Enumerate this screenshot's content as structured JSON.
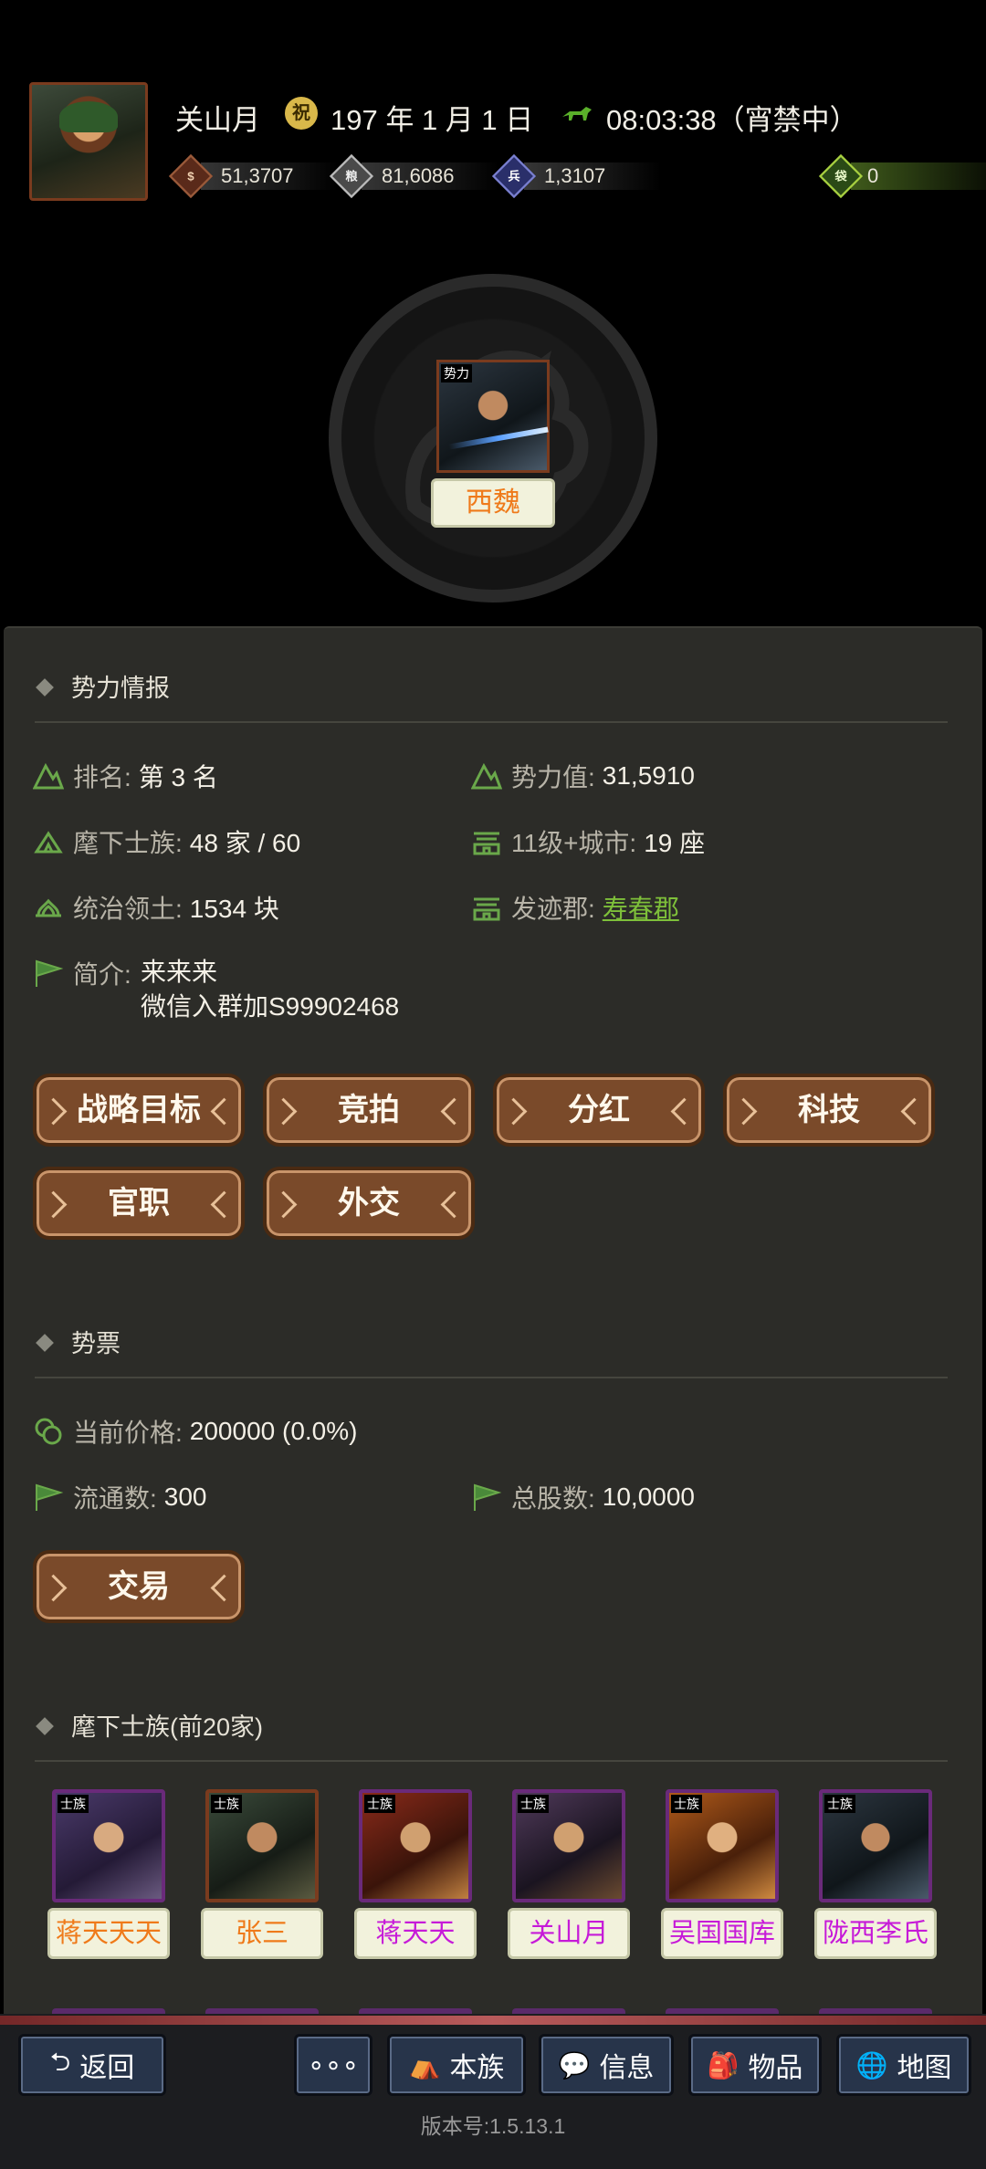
{
  "header": {
    "player_name": "关山月",
    "date_icon_glyph": "祝",
    "date": "197 年 1 月 1 日",
    "time": "08:03:38（宵禁中）",
    "resources": [
      {
        "icon": "coin-icon",
        "glyph": "$",
        "value": "51,3707"
      },
      {
        "icon": "grain-icon",
        "glyph": "粮",
        "value": "81,6086"
      },
      {
        "icon": "troop-icon",
        "glyph": "兵",
        "value": "1,3107"
      },
      {
        "icon": "bag-icon",
        "glyph": "袋",
        "value": "0"
      }
    ]
  },
  "faction": {
    "avatar_tag": "势力",
    "name": "西魏"
  },
  "power_info": {
    "title": "势力情报",
    "rank_label": "排名:",
    "rank_value": "第 3 名",
    "power_label": "势力值:",
    "power_value": "31,5910",
    "clans_label": "麾下士族:",
    "clans_value": "48 家 / 60",
    "cities_label": "11级+城市:",
    "cities_value": "19 座",
    "territory_label": "统治领土:",
    "territory_value": "1534 块",
    "origin_label": "发迹郡:",
    "origin_value": "寿春郡",
    "intro_label": "简介:",
    "intro_line1": "来来来",
    "intro_line2": "微信入群加S99902468"
  },
  "actions": [
    "战略目标",
    "竞拍",
    "分红",
    "科技",
    "官职",
    "外交"
  ],
  "stock": {
    "title": "势票",
    "price_label": "当前价格:",
    "price_value": "200000 (0.0%)",
    "circulating_label": "流通数:",
    "circulating_value": "300",
    "total_label": "总股数:",
    "total_value": "10,0000",
    "trade_button": "交易"
  },
  "clans": {
    "title": "麾下士族(前20家)",
    "tag": "士族",
    "items": [
      {
        "name": "蒋天天天",
        "color": "#ef7a1a"
      },
      {
        "name": "张三",
        "color": "#ef7a1a"
      },
      {
        "name": "蒋天天",
        "color": "#c61ad8"
      },
      {
        "name": "关山月",
        "color": "#c61ad8"
      },
      {
        "name": "吴国国库",
        "color": "#c61ad8"
      },
      {
        "name": "陇西李氏",
        "color": "#c61ad8"
      }
    ]
  },
  "nav": {
    "back": "返回",
    "more": "∘∘∘",
    "clan": "本族",
    "info": "信息",
    "items": "物品",
    "map": "地图"
  },
  "version": "版本号:1.5.13.1"
}
